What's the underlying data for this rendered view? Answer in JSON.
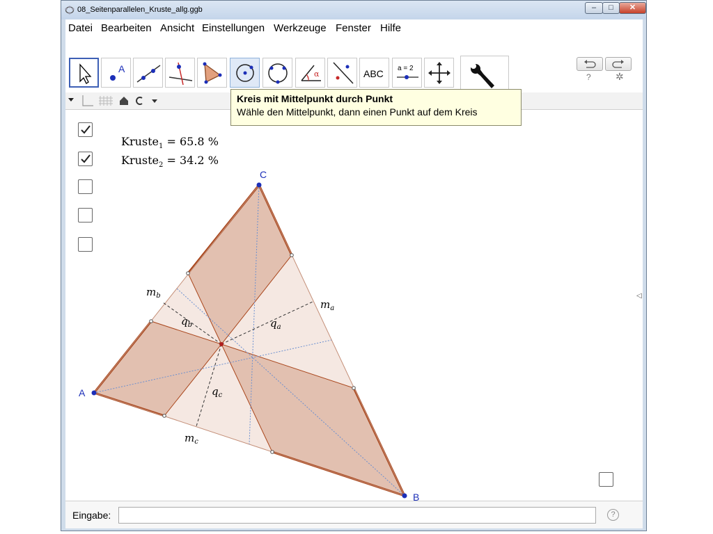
{
  "window": {
    "title": "08_Seitenparallelen_Kruste_allg.ggb",
    "controls": {
      "minimize": "–",
      "maximize": "□",
      "close": "✕"
    }
  },
  "menu": [
    "Datei",
    "Bearbeiten",
    "Ansicht",
    "Einstellungen",
    "Werkzeuge",
    "Fenster",
    "Hilfe"
  ],
  "toolbar": {
    "tools": [
      {
        "icon": "move-arrow-icon"
      },
      {
        "icon": "point-icon",
        "label": "A"
      },
      {
        "icon": "line-icon"
      },
      {
        "icon": "perpendicular-icon"
      },
      {
        "icon": "polygon-icon"
      },
      {
        "icon": "circle-center-point-icon"
      },
      {
        "icon": "circle-three-points-icon"
      },
      {
        "icon": "angle-icon",
        "label": "α"
      },
      {
        "icon": "reflect-icon"
      },
      {
        "icon": "text-icon",
        "label": "ABC"
      },
      {
        "icon": "slider-icon",
        "label": "a = 2"
      },
      {
        "icon": "move-view-icon"
      }
    ],
    "selected_index": 0,
    "hover_index": 5,
    "undo_icon": "undo-icon",
    "redo_icon": "redo-icon",
    "help_symbol": "?",
    "settings_icon": "gear-icon"
  },
  "tooltip": {
    "title": "Kreis mit Mittelpunkt durch Punkt",
    "description": "Wähle den Mittelpunkt, dann einen Punkt auf dem Kreis"
  },
  "checkboxes": [
    true,
    true,
    false,
    false,
    false
  ],
  "extra_checkbox": false,
  "results": {
    "kruste1": {
      "name": "Kruste",
      "index": "1",
      "value": "= 65.8 %"
    },
    "kruste2": {
      "name": "Kruste",
      "index": "2",
      "value": "= 34.2 %"
    }
  },
  "geometry": {
    "points": {
      "A": "A",
      "B": "B",
      "C": "C"
    },
    "labels": {
      "ma": {
        "letter": "m",
        "sub": "a"
      },
      "mb": {
        "letter": "m",
        "sub": "b"
      },
      "mc": {
        "letter": "m",
        "sub": "c"
      },
      "qa": {
        "letter": "q",
        "sub": "a"
      },
      "qb": {
        "letter": "q",
        "sub": "b"
      },
      "qc": {
        "letter": "q",
        "sub": "c"
      }
    },
    "colors": {
      "crust_fill": "#e2c0b0",
      "inner_fill": "#f5e8e2",
      "edge": "#a9461c",
      "point": "#1c2fb8",
      "center": "#b01e1e",
      "median": "#6a8fd0"
    }
  },
  "input_bar": {
    "label": "Eingabe:",
    "value": "",
    "help": "?"
  }
}
